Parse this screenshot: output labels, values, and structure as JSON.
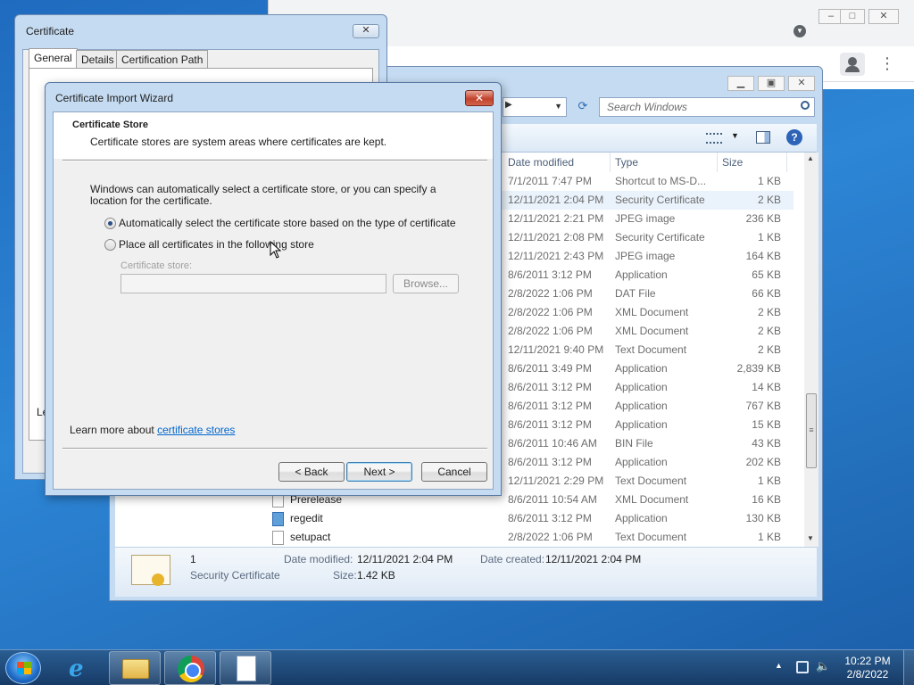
{
  "certificate_window": {
    "title": "Certificate",
    "close_glyph": "✕",
    "tabs": [
      "General",
      "Details",
      "Certification Path"
    ],
    "partial_text": "Le"
  },
  "wizard": {
    "title": "Certificate Import Wizard",
    "close_glyph": "✕",
    "heading": "Certificate Store",
    "subheading": "Certificate stores are system areas where certificates are kept.",
    "description": "Windows can automatically select a certificate store, or you can specify a location for the certificate.",
    "option_auto": "Automatically select the certificate store based on the type of certificate",
    "option_place": "Place all certificates in the following store",
    "store_label": "Certificate store:",
    "store_value": "",
    "browse_label": "Browse...",
    "learn_prefix": "Learn more about ",
    "learn_link": "certificate stores",
    "back_label": "< Back",
    "next_label": "Next >",
    "cancel_label": "Cancel",
    "selected_option": "auto"
  },
  "explorer": {
    "search_placeholder": "Search Windows",
    "help_glyph": "?",
    "columns": {
      "date": "Date modified",
      "type": "Type",
      "size": "Size"
    },
    "rows": [
      {
        "name": "",
        "date": "7/1/2011 7:47 PM",
        "type": "Shortcut to MS-D...",
        "size": "1 KB"
      },
      {
        "name": "",
        "date": "12/11/2021 2:04 PM",
        "type": "Security Certificate",
        "size": "2 KB"
      },
      {
        "name": "",
        "date": "12/11/2021 2:21 PM",
        "type": "JPEG image",
        "size": "236 KB"
      },
      {
        "name": "",
        "date": "12/11/2021 2:08 PM",
        "type": "Security Certificate",
        "size": "1 KB"
      },
      {
        "name": "",
        "date": "12/11/2021 2:43 PM",
        "type": "JPEG image",
        "size": "164 KB"
      },
      {
        "name": "",
        "date": "8/6/2011 3:12 PM",
        "type": "Application",
        "size": "65 KB"
      },
      {
        "name": "",
        "date": "2/8/2022 1:06 PM",
        "type": "DAT File",
        "size": "66 KB"
      },
      {
        "name": "",
        "date": "2/8/2022 1:06 PM",
        "type": "XML Document",
        "size": "2 KB"
      },
      {
        "name": "",
        "date": "2/8/2022 1:06 PM",
        "type": "XML Document",
        "size": "2 KB"
      },
      {
        "name": "",
        "date": "12/11/2021 9:40 PM",
        "type": "Text Document",
        "size": "2 KB"
      },
      {
        "name": "",
        "date": "8/6/2011 3:49 PM",
        "type": "Application",
        "size": "2,839 KB"
      },
      {
        "name": "",
        "date": "8/6/2011 3:12 PM",
        "type": "Application",
        "size": "14 KB"
      },
      {
        "name": "",
        "date": "8/6/2011 3:12 PM",
        "type": "Application",
        "size": "767 KB"
      },
      {
        "name": "",
        "date": "8/6/2011 3:12 PM",
        "type": "Application",
        "size": "15 KB"
      },
      {
        "name": "",
        "date": "8/6/2011 10:46 AM",
        "type": "BIN File",
        "size": "43 KB"
      },
      {
        "name": "",
        "date": "8/6/2011 3:12 PM",
        "type": "Application",
        "size": "202 KB"
      },
      {
        "name": "",
        "date": "12/11/2021 2:29 PM",
        "type": "Text Document",
        "size": "1 KB"
      },
      {
        "name": "Prerelease",
        "date": "8/6/2011 10:54 AM",
        "type": "XML Document",
        "size": "16 KB"
      },
      {
        "name": "regedit",
        "date": "8/6/2011 3:12 PM",
        "type": "Application",
        "size": "130 KB"
      },
      {
        "name": "setupact",
        "date": "2/8/2022 1:06 PM",
        "type": "Text Document",
        "size": "1 KB"
      }
    ],
    "details": {
      "name": "1",
      "type": "Security Certificate",
      "modified_label": "Date modified:",
      "modified_value": "12/11/2021 2:04 PM",
      "created_label": "Date created:",
      "created_value": "12/11/2021 2:04 PM",
      "size_label": "Size:",
      "size_value": "1.42 KB"
    }
  },
  "taskbar": {
    "time": "10:22 PM",
    "date": "2/8/2022"
  }
}
